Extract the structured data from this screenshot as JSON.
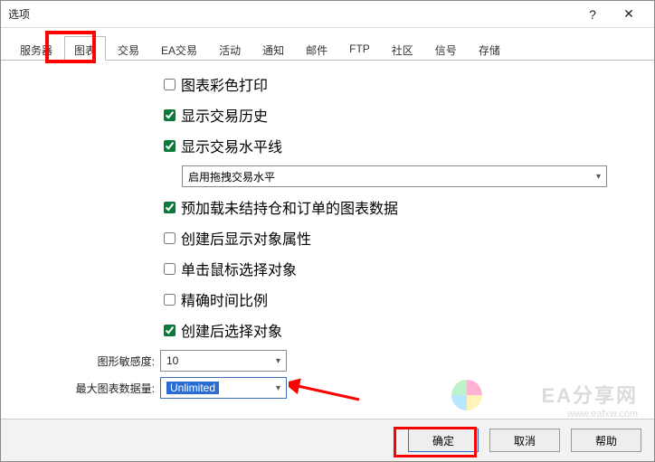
{
  "window": {
    "title": "选项"
  },
  "tabs": {
    "items": [
      "服务器",
      "图表",
      "交易",
      "EA交易",
      "活动",
      "通知",
      "邮件",
      "FTP",
      "社区",
      "信号",
      "存储"
    ],
    "active_index": 1
  },
  "options": {
    "cb1": {
      "label": "图表彩色打印",
      "checked": false
    },
    "cb2": {
      "label": "显示交易历史",
      "checked": true
    },
    "cb3": {
      "label": "显示交易水平线",
      "checked": true
    },
    "combo1": {
      "value": "启用拖拽交易水平"
    },
    "cb4": {
      "label": "预加载未结持仓和订单的图表数据",
      "checked": true
    },
    "cb5": {
      "label": "创建后显示对象属性",
      "checked": false
    },
    "cb6": {
      "label": "单击鼠标选择对象",
      "checked": false
    },
    "cb7": {
      "label": "精确时间比例",
      "checked": false
    },
    "cb8": {
      "label": "创建后选择对象",
      "checked": true
    },
    "sens": {
      "label": "图形敏感度:",
      "value": "10"
    },
    "maxdata": {
      "label": "最大图表数据量:",
      "value": "Unlimited"
    }
  },
  "buttons": {
    "ok": "确定",
    "cancel": "取消",
    "help": "帮助"
  },
  "watermark": {
    "line1": "EA分享网",
    "line2": "www.eafxw.com"
  }
}
